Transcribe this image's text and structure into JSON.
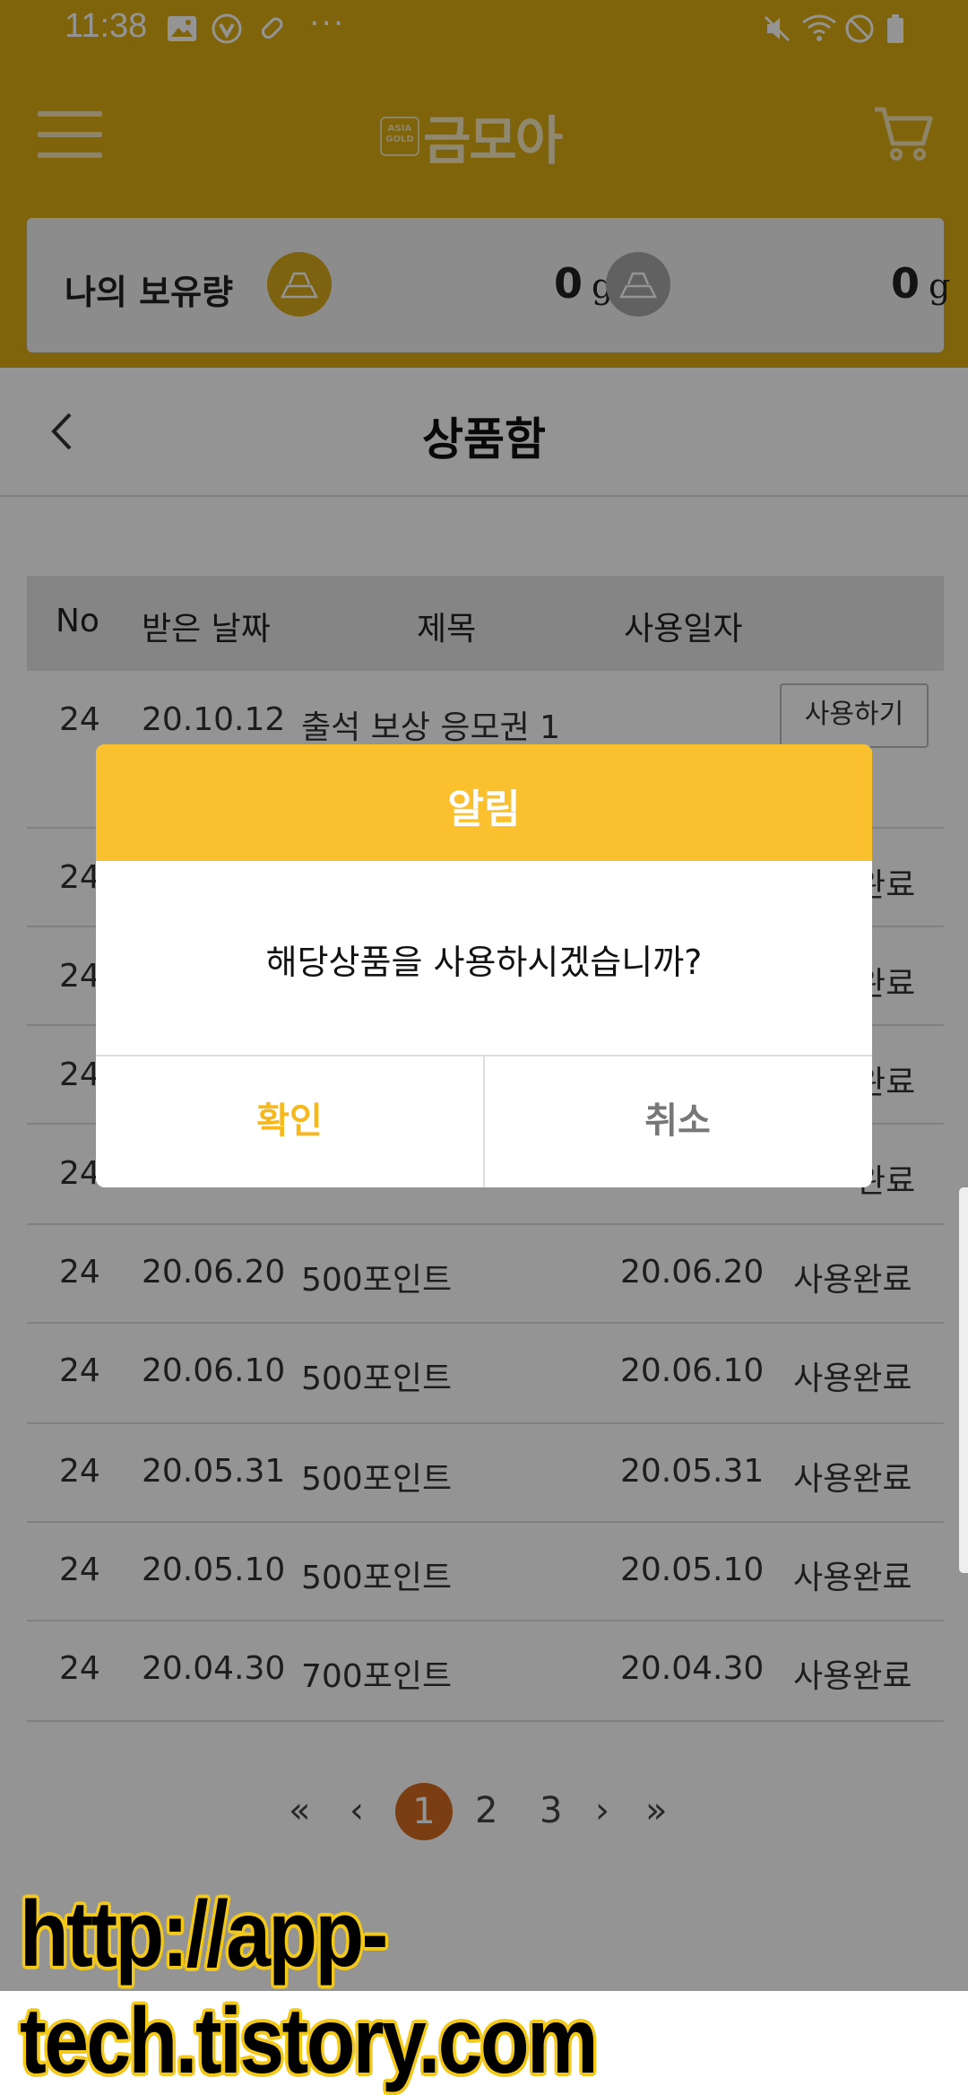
{
  "status_bar": {
    "time": "11:38",
    "more": "···"
  },
  "header": {
    "logo_badge_top": "ASIA",
    "logo_badge_bottom": "GOLD",
    "logo_text": "금모아"
  },
  "holdings": {
    "label": "나의 보유량",
    "gold_amount": "0",
    "gold_unit": "g",
    "silver_amount": "0",
    "silver_unit": "g"
  },
  "page": {
    "title": "상품함"
  },
  "table": {
    "headers": {
      "no": "No",
      "date": "받은 날짜",
      "title": "제목",
      "used_date": "사용일자"
    },
    "rows": [
      {
        "no": "24",
        "date": "20.10.12",
        "title": "출석 보상 응모권 1",
        "used": "",
        "status": "사용하기"
      },
      {
        "no": "24",
        "date": "",
        "title": "",
        "used": "",
        "status": "완료"
      },
      {
        "no": "24",
        "date": "",
        "title": "",
        "used": "",
        "status": "완료"
      },
      {
        "no": "24",
        "date": "",
        "title": "",
        "used": "",
        "status": "완료"
      },
      {
        "no": "24",
        "date": "",
        "title": "",
        "used": "",
        "status": "완료"
      },
      {
        "no": "24",
        "date": "20.06.20",
        "title": "500포인트",
        "used": "20.06.20",
        "status": "사용완료"
      },
      {
        "no": "24",
        "date": "20.06.10",
        "title": "500포인트",
        "used": "20.06.10",
        "status": "사용완료"
      },
      {
        "no": "24",
        "date": "20.05.31",
        "title": "500포인트",
        "used": "20.05.31",
        "status": "사용완료"
      },
      {
        "no": "24",
        "date": "20.05.10",
        "title": "500포인트",
        "used": "20.05.10",
        "status": "사용완료"
      },
      {
        "no": "24",
        "date": "20.04.30",
        "title": "700포인트",
        "used": "20.04.30",
        "status": "사용완료"
      }
    ]
  },
  "pagination": {
    "first": "«",
    "prev": "‹",
    "pages": [
      "1",
      "2",
      "3"
    ],
    "current": "1",
    "next": "›",
    "last": "»"
  },
  "dialog": {
    "title": "알림",
    "message": "해당상품을 사용하시겠습니까?",
    "confirm": "확인",
    "cancel": "취소"
  },
  "watermark": "http://app-tech.tistory.com",
  "colors": {
    "header_bg": "#dbac14",
    "dialog_header": "#fbc02d",
    "confirm_text": "#f6b81c",
    "page_current": "#d56a1f"
  }
}
